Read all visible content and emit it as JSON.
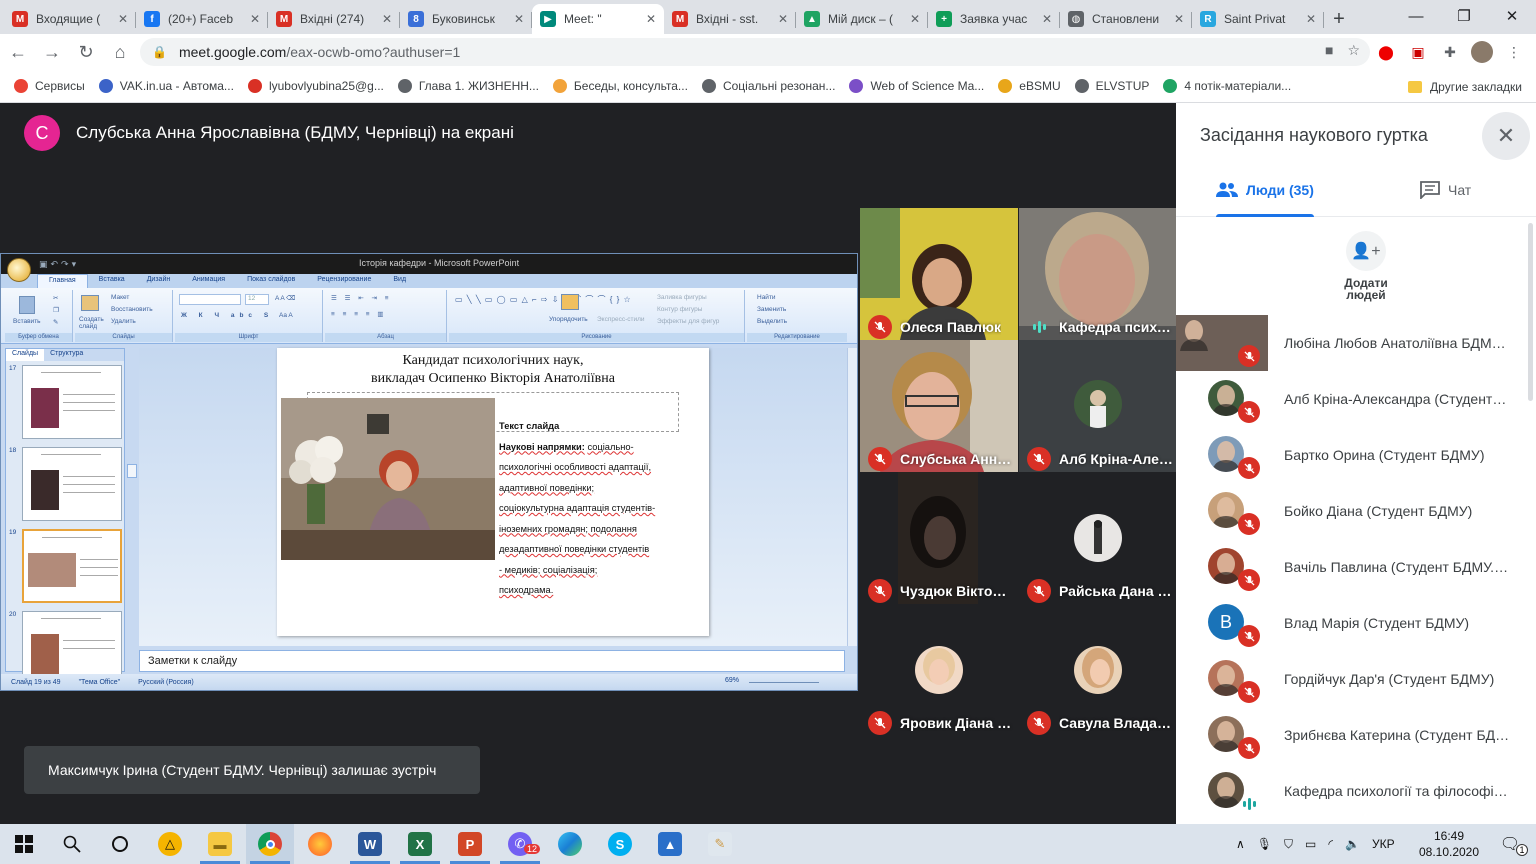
{
  "browser": {
    "tabs": [
      {
        "title": "Входящие (",
        "favicon": "gmail-icon",
        "color": "#d93025",
        "glyph": "M"
      },
      {
        "title": "(20+) Faceb",
        "favicon": "facebook-icon",
        "color": "#1877f2",
        "glyph": "f"
      },
      {
        "title": "Вхідні (274)",
        "favicon": "gmail-icon",
        "color": "#d93025",
        "glyph": "M"
      },
      {
        "title": "Буковинськ",
        "favicon": "site-icon",
        "color": "#3a6fd8",
        "glyph": "8"
      },
      {
        "title": "Meet: \"",
        "favicon": "meet-icon",
        "color": "#00897b",
        "glyph": "▶",
        "active": true
      },
      {
        "title": "Вхідні - sst.",
        "favicon": "gmail-icon",
        "color": "#d93025",
        "glyph": "M"
      },
      {
        "title": "Мій диск – (",
        "favicon": "drive-icon",
        "color": "#1fa463",
        "glyph": "▲"
      },
      {
        "title": "Заявка учас",
        "favicon": "sheets-icon",
        "color": "#0f9d58",
        "glyph": "+"
      },
      {
        "title": "Становлени",
        "favicon": "globe-icon",
        "color": "#5f6368",
        "glyph": "◍"
      },
      {
        "title": "Saint Privat",
        "favicon": "r-icon",
        "color": "#29a7df",
        "glyph": "R"
      }
    ],
    "new_tab": "+",
    "url_host": "meet.google.com",
    "url_path": "/eax-ocwb-omo?authuser=1",
    "bookmarks": [
      {
        "label": "Сервисы",
        "icon": "apps-grid-icon",
        "color": "#ea4335"
      },
      {
        "label": "VAK.in.ua - Автома...",
        "icon": "b-icon",
        "color": "#3c63c8"
      },
      {
        "label": "lyubovlyubina25@g...",
        "icon": "gmail-icon",
        "color": "#d93025"
      },
      {
        "label": "Глава 1. ЖИЗНЕНН...",
        "icon": "globe-icon",
        "color": "#5f6368"
      },
      {
        "label": "Беседы, консульта...",
        "icon": "psi-icon",
        "color": "#f2a33a"
      },
      {
        "label": "Соціальні резонан...",
        "icon": "globe-icon",
        "color": "#5f6368"
      },
      {
        "label": "Web of Science Ma...",
        "icon": "wos-icon",
        "color": "#7b4fc7"
      },
      {
        "label": "eBSMU",
        "icon": "ebsmu-icon",
        "color": "#e8a61a"
      },
      {
        "label": "ELVSTUP",
        "icon": "globe-icon",
        "color": "#5f6368"
      },
      {
        "label": "4 потік-матеріали...",
        "icon": "drive-icon",
        "color": "#1fa463"
      }
    ],
    "other_bookmarks": "Другие закладки"
  },
  "meet": {
    "presenter_initial": "С",
    "presenter_label": "Слубська Анна Ярославівна (БДМУ, Чернівці) на екрані",
    "toast": "Максимчук Ірина (Студент БДМУ. Чернівці) залишає зустріч",
    "tiles": [
      {
        "name": "Олеся Павлюк",
        "mic": "off"
      },
      {
        "name": "Кафедра психо...",
        "mic": "on"
      },
      {
        "name": "Слубська Анна ...",
        "mic": "off"
      },
      {
        "name": "Алб Кріна-Алек...",
        "mic": "off"
      },
      {
        "name": "Чуздюк Вікторі...",
        "mic": "off"
      },
      {
        "name": "Райська Дана (...",
        "mic": "off"
      },
      {
        "name": "Яровик Діана (С...",
        "mic": "off"
      },
      {
        "name": "Савула Влада (...",
        "mic": "off"
      }
    ]
  },
  "ppt": {
    "window_title": "Історія кафедри - Microsoft PowerPoint",
    "ribbon_tabs": [
      "Главная",
      "Вставка",
      "Дизайн",
      "Анимация",
      "Показ слайдов",
      "Рецензирование",
      "Вид"
    ],
    "groups": [
      "Буфер обмена",
      "Слайды",
      "Шрифт",
      "Абзац",
      "Рисование",
      "Редактирование"
    ],
    "ribbon_labels": {
      "paste": "Вставить",
      "create_slide": "Создать слайд",
      "layout": "Макет",
      "reset": "Восстановить",
      "delete": "Удалить",
      "arrange": "Упорядочить",
      "quick_styles": "Экспресс-стили",
      "shape_fill": "Заливка фигуры",
      "shape_outline": "Контур фигуры",
      "shape_effects": "Эффекты для фигур",
      "find": "Найти",
      "replace": "Заменить",
      "select": "Выделить",
      "font_size": "12"
    },
    "pane_tabs": [
      "Слайды",
      "Структура"
    ],
    "thumb_numbers": [
      "17",
      "18",
      "19",
      "20"
    ],
    "slide_title_1": "Кандидат психологічних наук,",
    "slide_title_2": "викладач Осипенко Вікторія Анатоліївна",
    "text_heading": "Текст слайда",
    "text_label": "Наукові напрямки:",
    "text_lines": [
      "соціально-",
      "психологічні особливості адаптації,",
      "адаптивної поведінки;",
      "соціокультурна адаптація студентів-",
      "іноземних громадян; подолання",
      "дезадаптивної поведінки студентів",
      "- медиків; соціалізація;",
      "психодрама."
    ],
    "notes_placeholder": "Заметки к слайду",
    "status_slide": "Слайд 19 из 49",
    "status_theme": "\"Тема Office\"",
    "status_lang": "Русский (Россия)",
    "zoom": "69%"
  },
  "panel": {
    "title": "Засідання наукового гуртка",
    "tab_people": "Люди (35)",
    "tab_chat": "Чат",
    "add_people": "Додати людей",
    "participants": [
      {
        "name": "Любіна Любов Анатоліївна БДМУ, ...",
        "avatar": "photo",
        "color": "#6d5f57"
      },
      {
        "name": "Алб Кріна-Александра (Студент БД...",
        "avatar": "photo",
        "color": "#3f5b3c"
      },
      {
        "name": "Бартко Орина (Студент БДМУ)",
        "avatar": "photo",
        "color": "#7e9bb8"
      },
      {
        "name": "Бойко Діана (Студент БДМУ)",
        "avatar": "photo",
        "color": "#c7a07a"
      },
      {
        "name": "Вачіль Павлина (Студент БДМУ. Че...",
        "avatar": "photo",
        "color": "#a0442e"
      },
      {
        "name": "Влад Марія (Студент БДМУ)",
        "avatar": "letter",
        "letter": "B",
        "color": "#1a73b8"
      },
      {
        "name": "Гордійчук Дар'я (Студент БДМУ)",
        "avatar": "photo",
        "color": "#b6735a"
      },
      {
        "name": "Зрибнєва Катерина (Студент БДМУ...",
        "avatar": "photo",
        "color": "#8c6f5a"
      },
      {
        "name": "Кафедра психології та філософії (Пі...",
        "avatar": "photo",
        "color": "#5d5040"
      }
    ]
  },
  "taskbar": {
    "lang": "УКР",
    "time": "16:49",
    "date": "08.10.2020",
    "notif_count": "1",
    "viber_badge": "12"
  }
}
